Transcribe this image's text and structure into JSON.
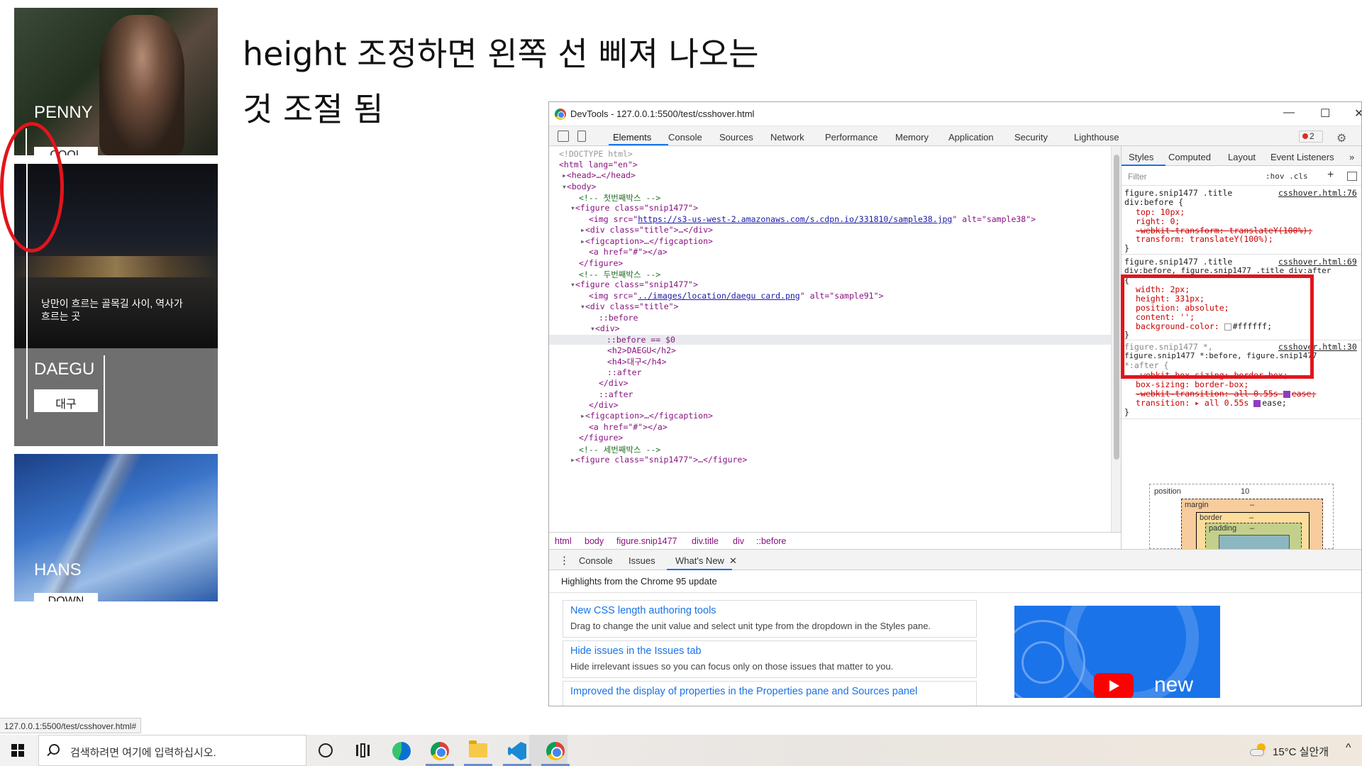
{
  "cards": {
    "card1_title": "PENNY",
    "card1_chip": "COOL",
    "card2_caption": "낭만이 흐르는 골목길 사이, 역사가 흐르는 곳",
    "card2_title": "DAEGU",
    "card2_chip": "대구",
    "card3_title": "HANS",
    "card3_chip": "DOWN"
  },
  "note": {
    "line1": "height 조정하면 왼쪽 선 삐져 나오는",
    "line2": "것 조절 됨"
  },
  "devtools": {
    "window_title": "DevTools - 127.0.0.1:5500/test/csshover.html",
    "win_minimize": "—",
    "win_maximize": "☐",
    "win_close": "✕",
    "tabs": [
      "Elements",
      "Console",
      "Sources",
      "Network",
      "Performance",
      "Memory",
      "Application",
      "Security",
      "Lighthouse"
    ],
    "error_count": "2",
    "tree": {
      "doctype": "<!DOCTYPE html>",
      "html_open": "<html lang=\"en\">",
      "head": "<head>…</head>",
      "body": "<body>",
      "comment1": "<!-- 첫번째박스 -->",
      "fig1_open": "<figure class=\"snip1477\">",
      "img1_tag": "<img src=\"",
      "img1_src": "https://s3-us-west-2.amazonaws.com/s.cdpn.io/331810/sample38.jpg",
      "img1_end": "\" alt=\"sample38\">",
      "div_title": "<div class=\"title\">…</div>",
      "figcaption": "<figcaption>…</figcaption>",
      "a_href": "<a href=\"#\"></a>",
      "fig_close": "</figure>",
      "comment2": "<!-- 두번째박스 -->",
      "fig2_open": "<figure class=\"snip1477\">",
      "img2_tag": "<img src=\"",
      "img2_src": "../images/location/daegu card.png",
      "img2_end": "\" alt=\"sample91\">",
      "div_title_open": "<div class=\"title\">",
      "before1": "::before",
      "div_open": "<div>",
      "before_sel": "::before == $0",
      "h2": "<h2>DAEGU</h2>",
      "h4": "<h4>대구</h4>",
      "after1": "::after",
      "div_close": "</div>",
      "after2": "::after",
      "div_close2": "</div>",
      "figcaption2": "<figcaption>…</figcaption>",
      "a_href2": "<a href=\"#\"></a>",
      "fig_close2": "</figure>",
      "comment3": "<!-- 세번째박스 -->",
      "fig3": "<figure class=\"snip1477\">…</figure>",
      "ellipsis": "…"
    },
    "breadcrumbs": [
      "html",
      "body",
      "figure.snip1477",
      "div.title",
      "div",
      "::before"
    ],
    "styles_tabs": [
      "Styles",
      "Computed",
      "Layout",
      "Event Listeners",
      "»"
    ],
    "filter_placeholder": "Filter",
    "hov_cls": ":hov  .cls",
    "plus": "+",
    "rule1": {
      "selector1": "figure.snip1477 .title",
      "selector2": "div:before {",
      "src": "csshover.html:76",
      "top": "top: 10px;",
      "right": "right: 0;",
      "webkit_transform": "-webkit-transform: translateY(100%);",
      "transform": "transform: translateY(100%);",
      "close": "}"
    },
    "rule2": {
      "selector1": "figure.snip1477 .title",
      "selector2": "div:before, figure.snip1477 .title div:after",
      "src": "csshover.html:69",
      "brace": "{",
      "width": "width: 2px;",
      "height": "height: 331px;",
      "position": "position: absolute;",
      "content": "content: '';",
      "bg_prop": "background-color:",
      "bg_val": "#ffffff;",
      "close": "}"
    },
    "rule3": {
      "selector1": "figure.snip1477 *,",
      "selector2": "figure.snip1477 *:before, figure.snip1477",
      "selector3": "*:after {",
      "src": "csshover.html:30",
      "webkit_box": "-webkit-box-sizing: border-box;",
      "box": "box-sizing: border-box;",
      "webkit_transition": "-webkit-transition: all 0.55s",
      "webkit_transition_ease": "ease;",
      "transition": "transition: ▸ all 0.55s",
      "transition_ease": "ease;",
      "close": "}"
    },
    "box_model": {
      "position_label": "position",
      "position_val": "10",
      "margin_label": "margin",
      "margin_val": "–",
      "border_label": "border",
      "border_val": "–",
      "padding_label": "padding",
      "padding_val": "–"
    },
    "drawer_tabs": [
      "Console",
      "Issues",
      "What's New"
    ],
    "drawer_close": "✕",
    "highlights": "Highlights from the Chrome 95 update",
    "whats_new": [
      {
        "title": "New CSS length authoring tools",
        "desc": "Drag to change the unit value and select unit type from the dropdown in the Styles pane."
      },
      {
        "title": "Hide issues in the Issues tab",
        "desc": "Hide irrelevant issues so you can focus only on those issues that matter to you."
      },
      {
        "title": "Improved the display of properties in the Properties pane and Sources panel",
        "desc": ""
      }
    ],
    "promo_text": "new"
  },
  "status_url": "127.0.0.1:5500/test/csshover.html#",
  "taskbar": {
    "search_placeholder": "검색하려면 여기에 입력하십시오.",
    "weather": "15°C  실안개",
    "chevron": "^"
  },
  "colors": {
    "annotation_red": "#e3141b",
    "devtools_blue": "#1a73e8"
  }
}
